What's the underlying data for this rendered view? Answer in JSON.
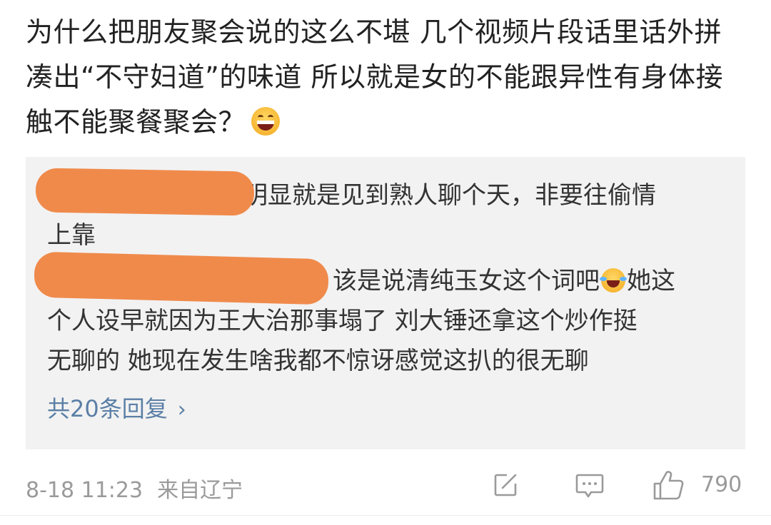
{
  "post": {
    "text": "为什么把朋友聚会说的这么不堪 几个视频片段话里话外拼凑出“不守妇道”的味道 所以就是女的不能跟异性有身体接触不能聚餐聚会？",
    "emoji": "grinning-face-emoji"
  },
  "replies": [
    {
      "line1": "明显就是见到熟人聊个天，非要往偷情",
      "line2": "上靠"
    },
    {
      "line1a": "该是说清纯玉女这个词吧",
      "line1b": "她这",
      "line2": "个人设早就因为王大治那事塌了  刘大锤还拿这个炒作挺",
      "line3": "无聊的  她现在发生啥我都不惊讶感觉这扒的很无聊"
    }
  ],
  "more_replies": {
    "label": "共20条回复",
    "chevron": "›"
  },
  "footer": {
    "timestamp": "8-18 11:23",
    "location": "来自辽宁",
    "like_count": "790"
  },
  "colors": {
    "reply_bg": "#f2f2f2",
    "link": "#5b7fa6",
    "redaction": "#f08a4b",
    "meta": "#9a9a9a"
  }
}
